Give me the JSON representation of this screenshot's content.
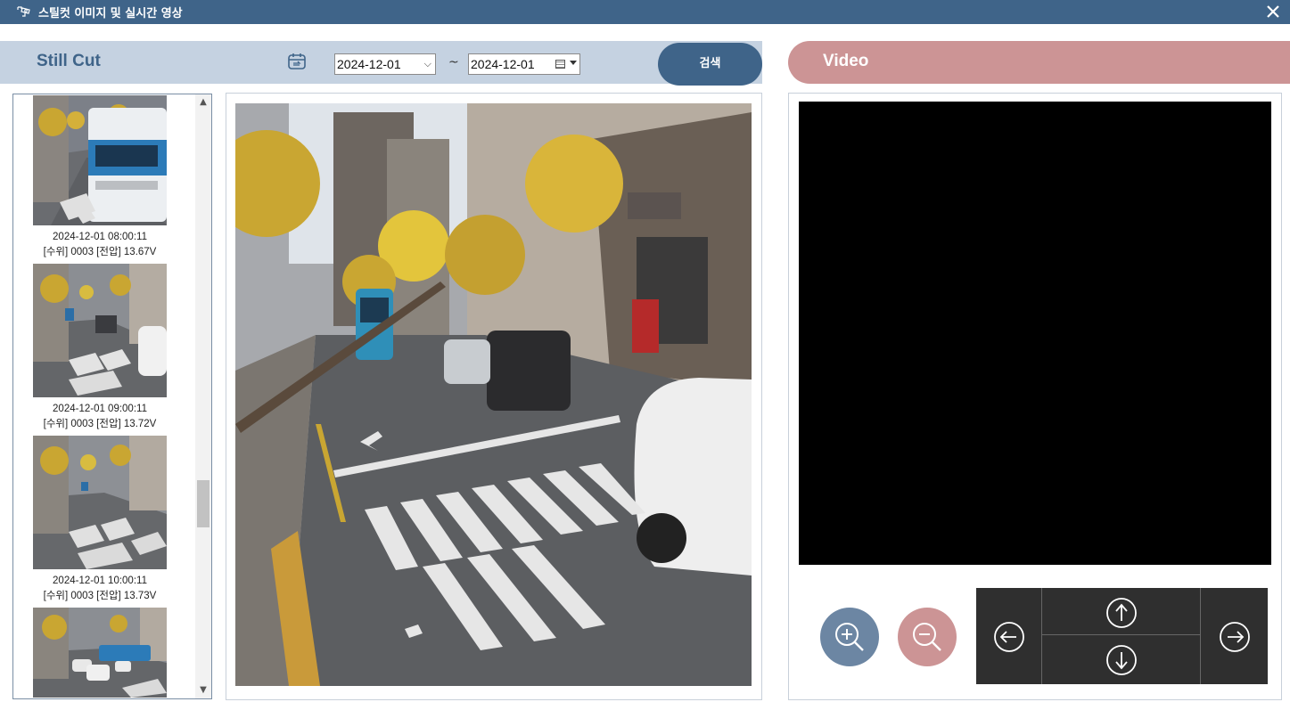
{
  "window": {
    "title": "스틸컷 이미지 및 실시간 영상"
  },
  "still": {
    "title": "Still Cut",
    "date_from": "2024-12-01",
    "date_to": "2024-12-01",
    "separator": "~",
    "search_label": "검색"
  },
  "video": {
    "title": "Video"
  },
  "thumbnails": [
    {
      "timestamp": "",
      "info": ""
    },
    {
      "timestamp": "2024-12-01 08:00:11",
      "info": "[수위] 0003 [전압] 13.67V"
    },
    {
      "timestamp": "2024-12-01 09:00:11",
      "info": "[수위] 0003 [전압] 13.72V"
    },
    {
      "timestamp": "2024-12-01 10:00:11",
      "info": "[수위] 0003 [전압] 13.73V"
    }
  ],
  "colors": {
    "titlebar": "#3f6489",
    "still_band": "#c5d2e1",
    "video_band": "#cc9495",
    "zoom_in": "#6c86a3",
    "zoom_out": "#cc9495"
  },
  "icons": {
    "titlebar": "camera-icon",
    "close": "close-icon",
    "calendar": "calendar-icon",
    "zoom_in": "zoom-in-icon",
    "zoom_out": "zoom-out-icon",
    "pan_left": "arrow-left-icon",
    "tilt_up": "arrow-up-icon",
    "tilt_down": "arrow-down-icon",
    "pan_right": "arrow-right-icon"
  }
}
